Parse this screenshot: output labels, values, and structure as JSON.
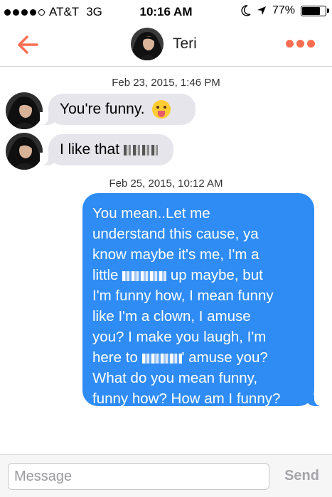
{
  "status_bar": {
    "carrier": "AT&T",
    "network": "3G",
    "time": "10:16 AM",
    "battery": "77%",
    "battery_level": 0.77
  },
  "header": {
    "contact_name": "Teri",
    "back_icon": "back-arrow-icon",
    "more_icon": "more-dots-icon",
    "accent_color": "#fb6e52"
  },
  "conversation": {
    "timestamps": [
      "Feb 23, 2015, 1:46 PM",
      "Feb 25, 2015, 10:12 AM"
    ],
    "incoming": [
      {
        "text": "You're funny.",
        "emoji": "tongue-out-emoji"
      },
      {
        "text": "I like that",
        "redacted": true
      }
    ],
    "outgoing": {
      "lines": [
        "You mean..Let me",
        "understand this cause, ya",
        "know maybe it's me, I'm a",
        "little",
        "up maybe, but",
        "I'm funny how, I mean funny",
        "like I'm a clown, I amuse",
        "you? I make you laugh, I'm",
        "here to",
        "' amuse you?",
        "What do you mean funny,",
        "funny how? How am I funny?"
      ],
      "bubble_color": "#2f8cf5"
    }
  },
  "composer": {
    "placeholder": "Message",
    "send_label": "Send"
  }
}
